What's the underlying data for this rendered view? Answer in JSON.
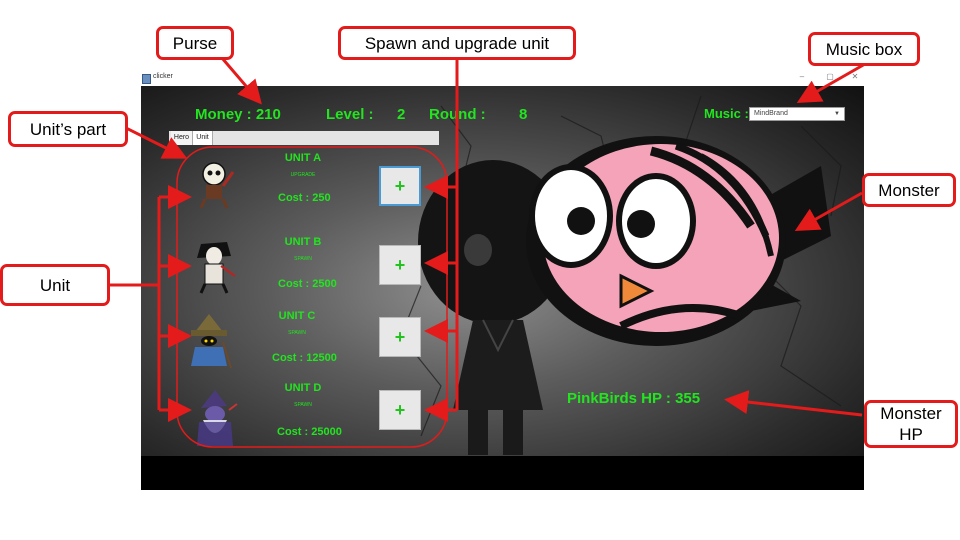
{
  "annotations": {
    "purse": "Purse",
    "spawn_upgrade": "Spawn and upgrade unit",
    "music_box": "Music box",
    "units_part": "Unit’s part",
    "monster": "Monster",
    "unit": "Unit",
    "monster_hp": "Monster HP"
  },
  "window": {
    "title": "clicker",
    "minimize": "–",
    "maximize": "▢",
    "close": "✕"
  },
  "hud": {
    "money_label": "Money : 210",
    "level_label": "Level :",
    "level_value": "2",
    "round_label": "Round :",
    "round_value": "8",
    "music_label": "Music :",
    "music_selected": "MindBrand"
  },
  "tabs": [
    "Hero",
    "Unit"
  ],
  "units": [
    {
      "name": "UNIT A",
      "action": "UPGRADE",
      "cost": "Cost :  250",
      "button": "+"
    },
    {
      "name": "UNIT B",
      "action": "SPAWN",
      "cost": "Cost :  2500",
      "button": "+"
    },
    {
      "name": "UNIT C",
      "action": "SPAWN",
      "cost": "Cost :  12500",
      "button": "+"
    },
    {
      "name": "UNIT D",
      "action": "SPAWN",
      "cost": "Cost :  25000",
      "button": "+"
    }
  ],
  "monster": {
    "hp_label": "PinkBirds HP  :  355"
  },
  "colors": {
    "annotation_red": "#e31b1b",
    "hud_green": "#22e51f",
    "monster_pink": "#f4a3b8"
  }
}
